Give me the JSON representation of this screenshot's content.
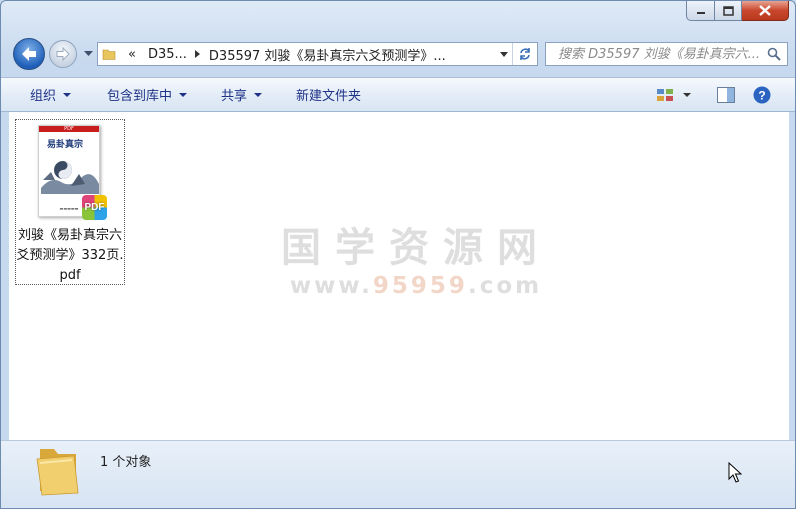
{
  "window": {
    "caption_buttons": [
      "minimize",
      "maximize",
      "close"
    ]
  },
  "nav": {
    "back_icon": "back-arrow-icon",
    "forward_icon": "forward-arrow-icon"
  },
  "address": {
    "overflow": "«",
    "segment1": "D35...",
    "segment2": "D35597 刘骏《易卦真宗六爻预测学》...",
    "refresh_icon": "refresh-icon"
  },
  "search": {
    "placeholder": "搜索 D35597 刘骏《易卦真宗六..."
  },
  "toolbar": {
    "organize": "组织",
    "include_library": "包含到库中",
    "share": "共享",
    "new_folder": "新建文件夹"
  },
  "file": {
    "name": "刘骏《易卦真宗六爻预测学》332页.pdf",
    "badge": "PDF",
    "thumb_band": "PDF",
    "thumb_title": "易卦真宗"
  },
  "watermark": {
    "cn": "国学资源网",
    "url_prefix": "www.",
    "url_highlight": "95959",
    "url_suffix": ".com"
  },
  "status": {
    "count": "1 个对象"
  },
  "colors": {
    "accent": "#1e3287",
    "close_red": "#c9462c"
  }
}
